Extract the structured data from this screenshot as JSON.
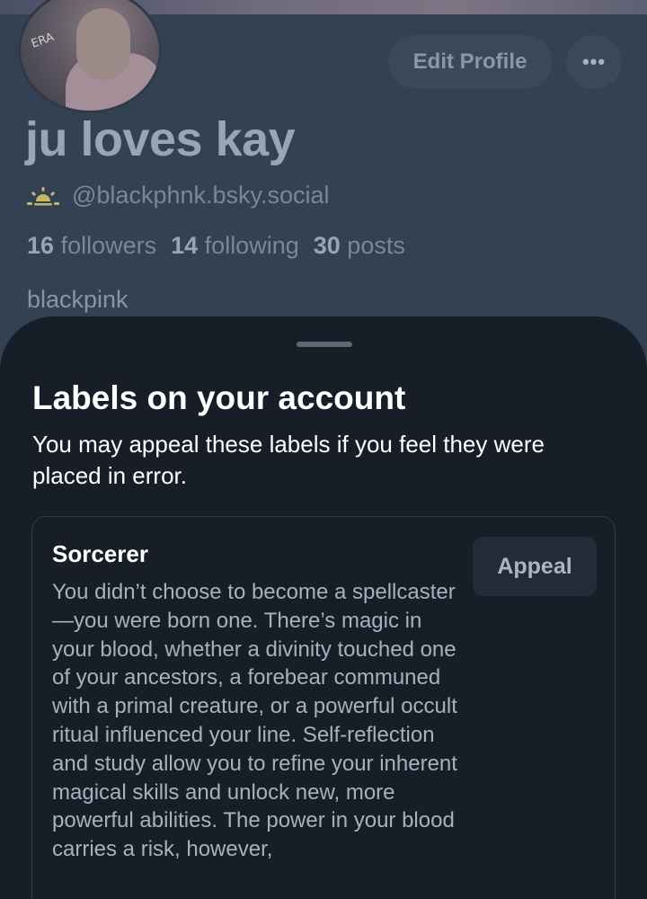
{
  "profile": {
    "display_name": "ju loves kay",
    "handle": "@blackphnk.bsky.social",
    "followers_count": "16",
    "followers_label": "followers",
    "following_count": "14",
    "following_label": "following",
    "posts_count": "30",
    "posts_label": "posts",
    "bio": "blackpink",
    "avatar_doodle_text": "ERA",
    "edit_button": "Edit Profile",
    "more_button": "•••",
    "handle_icon": "sun-icon",
    "handle_icon_color": "#c9b66a"
  },
  "sheet": {
    "title": "Labels on your account",
    "description": "You may appeal these labels if you feel they were placed in error.",
    "labels": [
      {
        "name": "Sorcerer",
        "appeal_button": "Appeal",
        "description": "You didn’t choose to become a spellcaster—you were born one. There’s magic in your blood, whether a divinity touched one of your ancestors, a forebear communed with a primal creature, or a powerful occult ritual influenced your line. Self-reflection and study allow you to refine your inherent magical skills and unlock new, more powerful abilities. The power in your blood carries a risk, however,"
      }
    ]
  },
  "colors": {
    "profile_bg": "#344152",
    "sheet_bg": "#181e27",
    "text_primary": "#ffffff",
    "text_muted": "#a7b1be"
  }
}
